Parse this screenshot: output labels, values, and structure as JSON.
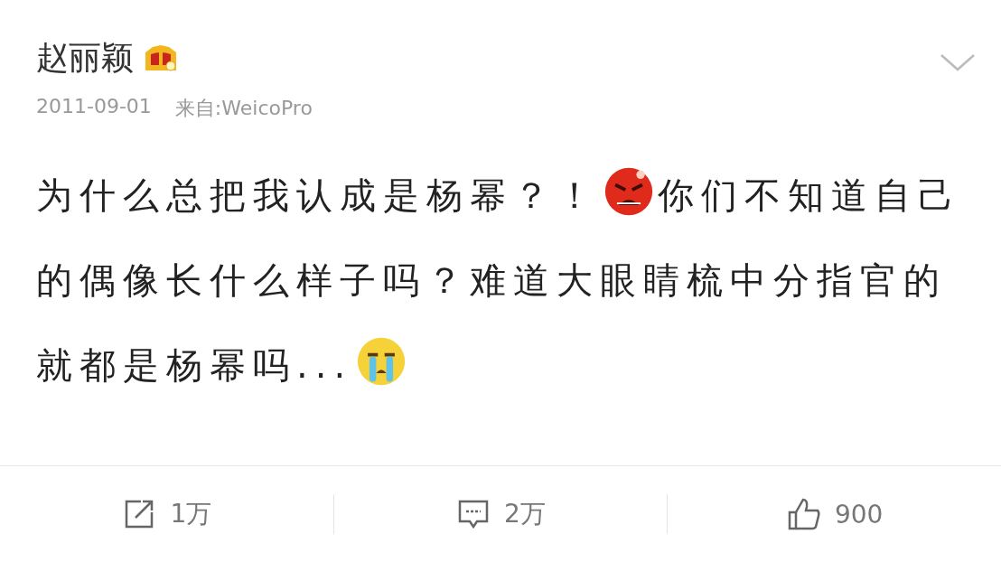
{
  "post": {
    "author": "赵丽颖",
    "date": "2011-09-01",
    "source": "来自:WeicoPro",
    "content": [
      {
        "kind": "text",
        "text": "为什么总把我认成是杨幂？！"
      },
      {
        "kind": "angry-emoji"
      },
      {
        "kind": "text",
        "text": "你们不知道自己的偶像长什么样子吗？难道大眼睛梳中分指官的就都是杨幂吗..."
      },
      {
        "kind": "crying-emoji"
      }
    ]
  },
  "actions": [
    {
      "kind": "repost",
      "count": "1万"
    },
    {
      "kind": "comment",
      "count": "2万"
    },
    {
      "kind": "like",
      "count": "900"
    }
  ]
}
